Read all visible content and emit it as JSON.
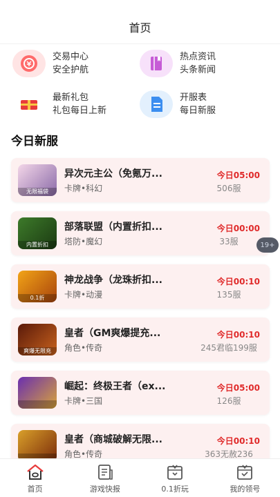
{
  "header": {
    "title": "首页"
  },
  "quick_links": [
    {
      "line1": "交易中心",
      "line2": "安全护航",
      "icon": "trade-icon",
      "color": "#ff6b6b",
      "bg": "#ffe4e4"
    },
    {
      "line1": "热点资讯",
      "line2": "头条新闻",
      "icon": "news-icon",
      "color": "#c65bd6",
      "bg": "#f7e1fa"
    },
    {
      "line1": "最新礼包",
      "line2": "礼包每日上新",
      "icon": "gift-icon",
      "color": "#e83b3b",
      "bg": "#ffffff"
    },
    {
      "line1": "开服表",
      "line2": "每日新服",
      "icon": "schedule-icon",
      "color": "#3c8ef0",
      "bg": "#e3f0fd"
    }
  ],
  "section": {
    "title": "今日新服"
  },
  "games": [
    {
      "name": "异次元主公（免氪万...",
      "tags": "卡牌•科幻",
      "time": "今日05:00",
      "server": "506服",
      "thumb_caption": "无限福袋",
      "thumb_colors": [
        "#f3d6e8",
        "#8a6aa8"
      ]
    },
    {
      "name": "部落联盟（内置折扣...",
      "tags": "塔防•魔幻",
      "time": "今日00:00",
      "server": "33服",
      "thumb_caption": "内置折扣",
      "thumb_colors": [
        "#3d7a2a",
        "#1b3a12"
      ]
    },
    {
      "name": "神龙战争（龙珠折扣...",
      "tags": "卡牌•动漫",
      "time": "今日00:10",
      "server": "135服",
      "thumb_caption": "0.1折",
      "thumb_colors": [
        "#f2a417",
        "#a8430c"
      ]
    },
    {
      "name": "皇者（GM爽爆提充...",
      "tags": "角色•传奇",
      "time": "今日00:10",
      "server": "245君临199服",
      "thumb_caption": "爽爆无限充",
      "thumb_colors": [
        "#5a1a0a",
        "#c9621d"
      ]
    },
    {
      "name": "崛起：终极王者（ex...",
      "tags": "卡牌•三国",
      "time": "今日05:00",
      "server": "126服",
      "thumb_caption": "",
      "thumb_colors": [
        "#6a2fb0",
        "#d9a33a"
      ]
    },
    {
      "name": "皇者（商城破解无限...",
      "tags": "角色•传奇",
      "time": "今日00:10",
      "server": "363无赦236",
      "thumb_caption": "",
      "thumb_colors": [
        "#d9a02a",
        "#7a2a0a"
      ]
    }
  ],
  "float_badge": {
    "label": "19+"
  },
  "tabbar": [
    {
      "label": "首页",
      "icon": "home-icon",
      "active": true
    },
    {
      "label": "游戏快报",
      "icon": "report-icon",
      "active": false
    },
    {
      "label": "0.1折玩",
      "icon": "discount-box-icon",
      "active": false
    },
    {
      "label": "我的领号",
      "icon": "claim-box-icon",
      "active": false
    }
  ]
}
